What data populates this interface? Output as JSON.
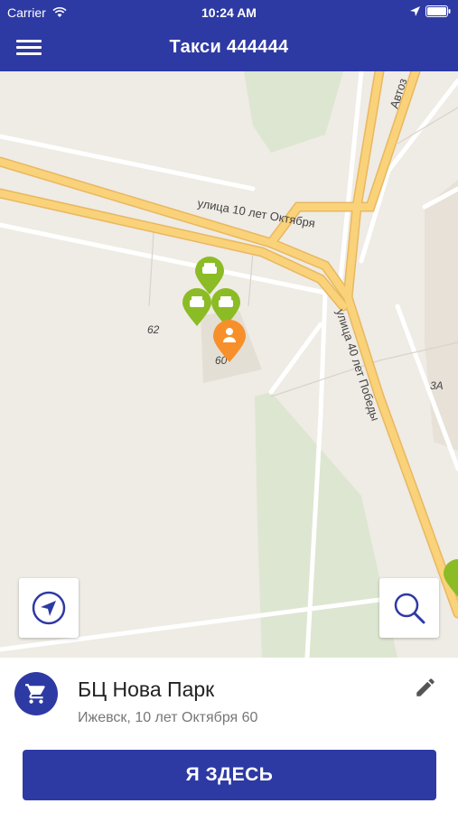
{
  "status_bar": {
    "carrier": "Carrier",
    "time": "10:24 AM"
  },
  "navbar": {
    "title": "Такси 444444"
  },
  "map": {
    "street_labels": [
      "улица 10 лет Октября",
      "улица 40 лет Победы",
      "Автоз"
    ],
    "building_numbers": [
      "62",
      "60",
      "3А"
    ],
    "markers": {
      "taxi_count": 3,
      "user_marker_color": "#f7902a",
      "taxi_marker_color": "#8cbc25"
    }
  },
  "location": {
    "name": "БЦ Нова Парк",
    "address": "Ижевск, 10 лет Октября 60"
  },
  "action": {
    "label": "Я ЗДЕСЬ"
  },
  "colors": {
    "primary": "#2e3aa3",
    "map_bg": "#efebe5",
    "road": "#fad27a",
    "park": "#dde6d1"
  }
}
